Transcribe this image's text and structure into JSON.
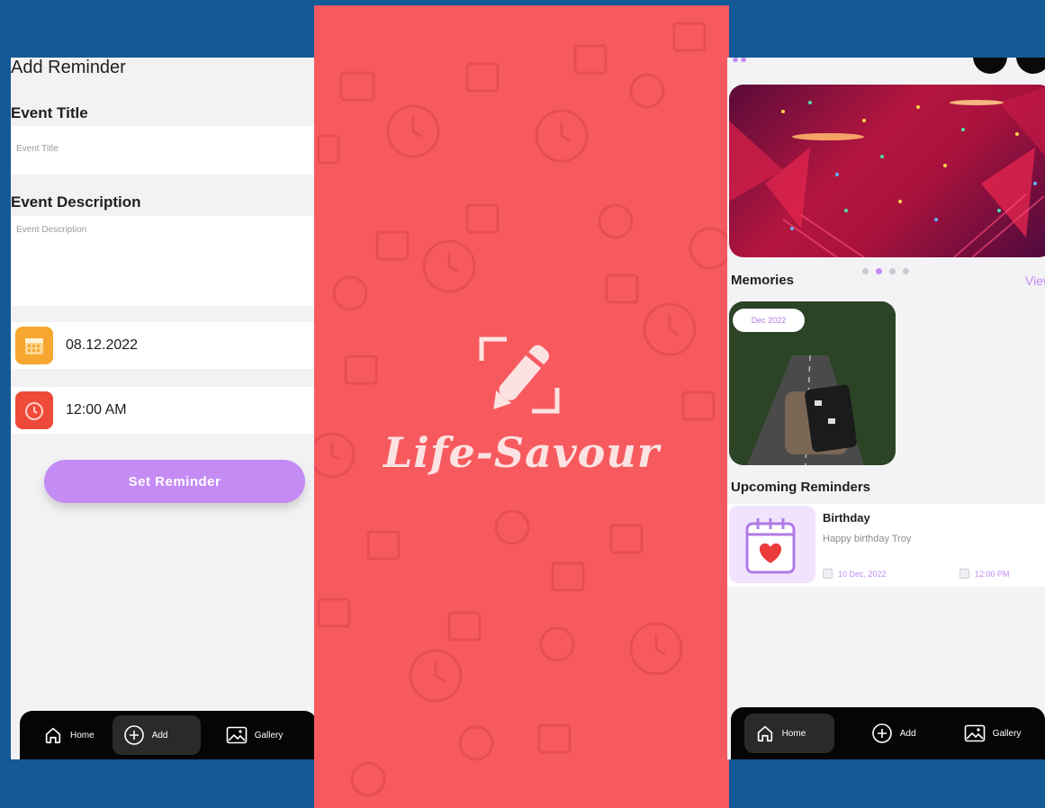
{
  "add_reminder": {
    "page_title": "Add Reminder",
    "event_title_label": "Event Title",
    "event_title_placeholder": "Event Title",
    "event_description_label": "Event Description",
    "event_description_placeholder": "Event Description",
    "date_value": "08.12.2022",
    "time_value": "12:00 AM",
    "set_button": "Set Reminder",
    "nav": [
      {
        "label": "Home",
        "icon": "home-icon"
      },
      {
        "label": "Add",
        "icon": "plus-circle-icon"
      },
      {
        "label": "Gallery",
        "icon": "gallery-icon"
      }
    ],
    "active_nav": "Add"
  },
  "splash": {
    "app_name": "Life-Savour",
    "logo_icon": "pencil-frame-icon"
  },
  "home": {
    "memories_title": "Memories",
    "view_all": "View",
    "memory_badge": "Dec 2022",
    "carousel_dots": 4,
    "carousel_active": 1,
    "upcoming_title": "Upcoming Reminders",
    "reminder": {
      "title": "Birthday",
      "description": "Happy birthday  Troy",
      "date": "10 Dec, 2022",
      "time": "12:00 PM"
    },
    "nav": [
      {
        "label": "Home",
        "icon": "home-icon"
      },
      {
        "label": "Add",
        "icon": "plus-circle-icon"
      },
      {
        "label": "Gallery",
        "icon": "gallery-icon"
      }
    ],
    "active_nav": "Home"
  },
  "colors": {
    "background": "#135a96",
    "splash": "#f65a5f",
    "accent": "#c48bf4",
    "calendar_icon": "#f6a72f",
    "clock_icon": "#ee4a3a"
  }
}
